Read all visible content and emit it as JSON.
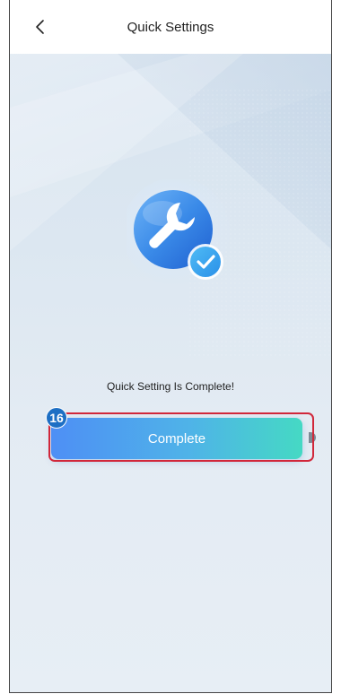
{
  "header": {
    "title": "Quick Settings",
    "back_icon": "chevron-left-icon"
  },
  "hero": {
    "icon": "wrench-icon",
    "badge_icon": "checkmark-icon"
  },
  "status": {
    "message": "Quick Setting Is Complete!"
  },
  "actions": {
    "complete_label": "Complete"
  },
  "annotation": {
    "step_number": "16"
  },
  "colors": {
    "accent_start": "#4e8ff5",
    "accent_end": "#45d9c4",
    "highlight": "#d1273a",
    "step_badge": "#1d6fc4"
  }
}
